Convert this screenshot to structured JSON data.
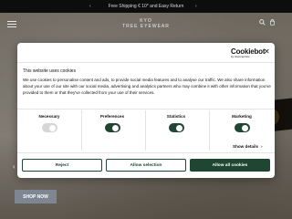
{
  "topbar": {
    "text": "Free Shipping € 10* and Easy Return",
    "prev_icon": "chevron-left-icon",
    "next_icon": "chevron-right-icon"
  },
  "nav": {
    "logo_line1": "KYO",
    "logo_line2": "TREE EYEWEAR",
    "menu_icon": "hamburger-menu-icon",
    "search_icon": "search-icon",
    "cart_icon": "cart-icon"
  },
  "hero": {
    "shop_label": "SHOP NOW"
  },
  "cookie_dialog": {
    "brand": "Cookiebot",
    "brand_sub": "by Usercentrics",
    "title": "This website uses cookies",
    "body": "We use cookies to personalise content and ads, to provide social media features and to analyse our traffic. We also share information about your use of our site with our social media, advertising and analytics partners who may combine it with other information that you've provided to them or that they've collected from your use of their services.",
    "categories": [
      {
        "label": "Necessary",
        "state": "disabled-on"
      },
      {
        "label": "Preferences",
        "state": "on"
      },
      {
        "label": "Statistics",
        "state": "on"
      },
      {
        "label": "Marketing",
        "state": "on"
      }
    ],
    "show_details": "Show details",
    "buttons": {
      "reject": "Reject",
      "allow_selection": "Allow selection",
      "allow_all": "Allow all cookies"
    }
  },
  "colors": {
    "accent": "#1e4633",
    "toggle_disabled": "#d6d6d6",
    "shop_button": "#7e8791"
  }
}
